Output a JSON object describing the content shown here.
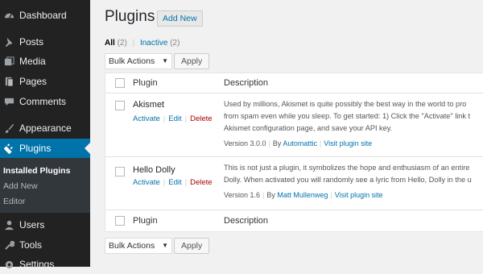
{
  "sidebar": {
    "items": [
      {
        "label": "Dashboard",
        "icon": "dashboard-icon"
      },
      {
        "label": "Posts",
        "icon": "pin-icon"
      },
      {
        "label": "Media",
        "icon": "media-icon"
      },
      {
        "label": "Pages",
        "icon": "pages-icon"
      },
      {
        "label": "Comments",
        "icon": "comment-icon"
      },
      {
        "label": "Appearance",
        "icon": "brush-icon"
      },
      {
        "label": "Plugins",
        "icon": "plugin-icon"
      },
      {
        "label": "Users",
        "icon": "users-icon"
      },
      {
        "label": "Tools",
        "icon": "wrench-icon"
      },
      {
        "label": "Settings",
        "icon": "settings-icon"
      }
    ],
    "submenu": [
      "Installed Plugins",
      "Add New",
      "Editor"
    ]
  },
  "main": {
    "title": "Plugins",
    "add_new": "Add New",
    "filters": {
      "all": "All",
      "all_count": "(2)",
      "inactive": "Inactive",
      "inactive_count": "(2)",
      "separator": "|"
    },
    "bulk_top": {
      "selected": "Bulk Actions",
      "apply": "Apply"
    },
    "bulk_bottom": {
      "selected": "Bulk Actions",
      "apply": "Apply"
    },
    "table": {
      "col_plugin": "Plugin",
      "col_description": "Description",
      "rows": [
        {
          "name": "Akismet",
          "actions": {
            "activate": "Activate",
            "edit": "Edit",
            "delete": "Delete"
          },
          "desc_lines": [
            "Used by millions, Akismet is quite possibly the best way in the world to pro",
            "from spam even while you sleep. To get started: 1) Click the \"Activate\" link t",
            "Akismet configuration page, and save your API key."
          ],
          "version": "Version 3.0.0",
          "by": "By",
          "author": "Automattic",
          "site": "Visit plugin site"
        },
        {
          "name": "Hello Dolly",
          "actions": {
            "activate": "Activate",
            "edit": "Edit",
            "delete": "Delete"
          },
          "desc_lines": [
            "This is not just a plugin, it symbolizes the hope and enthusiasm of an entire",
            "Dolly. When activated you will randomly see a lyric from Hello, Dolly in the u"
          ],
          "version": "Version 1.6",
          "by": "By",
          "author": "Matt Mullenweg",
          "site": "Visit plugin site"
        }
      ]
    }
  },
  "colors": {
    "sidebar_bg": "#222222",
    "active": "#0073aa",
    "submenu_bg": "#32373c",
    "link": "#0073aa",
    "delete": "#aa0000"
  }
}
